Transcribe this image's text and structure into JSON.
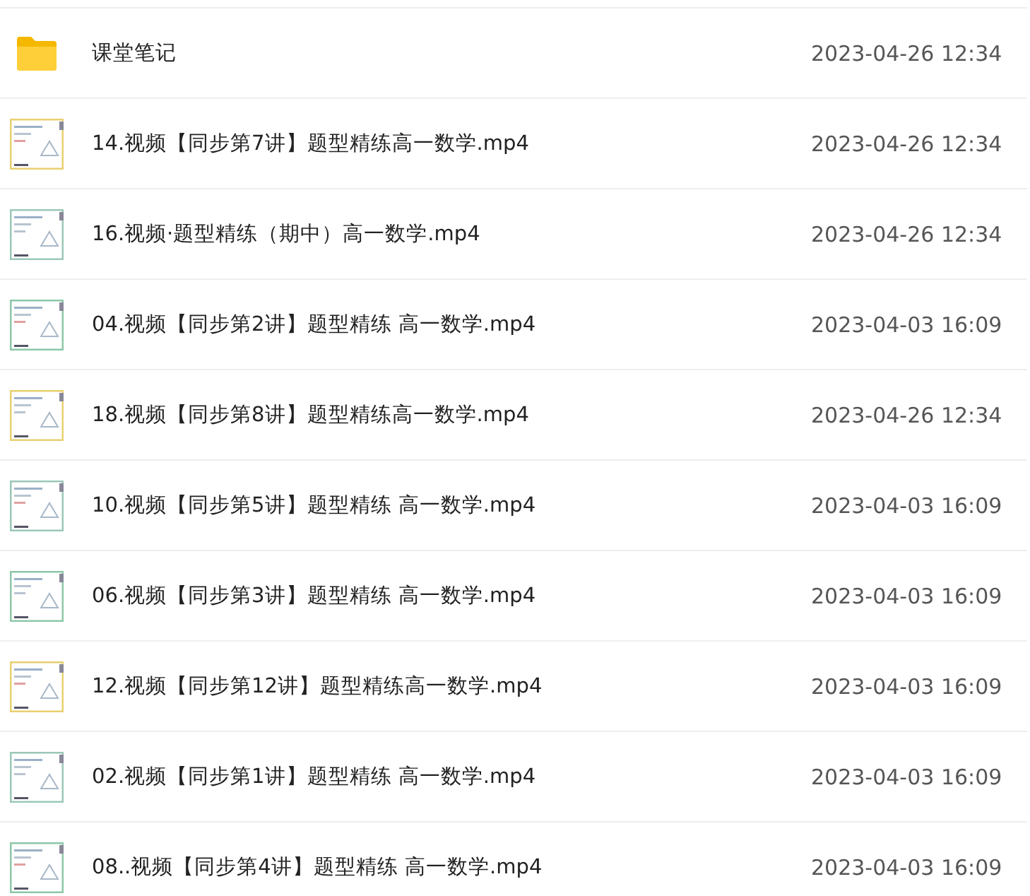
{
  "files": [
    {
      "kind": "folder",
      "name": "课堂笔记",
      "modified": "2023-04-26 12:34"
    },
    {
      "kind": "video",
      "name": "14.视频【同步第7讲】题型精练高一数学.mp4",
      "modified": "2023-04-26 12:34"
    },
    {
      "kind": "video",
      "name": "16.视频·题型精练（期中）高一数学.mp4",
      "modified": "2023-04-26 12:34"
    },
    {
      "kind": "video",
      "name": "04.视频【同步第2讲】题型精练 高一数学.mp4",
      "modified": "2023-04-03 16:09"
    },
    {
      "kind": "video",
      "name": "18.视频【同步第8讲】题型精练高一数学.mp4",
      "modified": "2023-04-26 12:34"
    },
    {
      "kind": "video",
      "name": "10.视频【同步第5讲】题型精练 高一数学.mp4",
      "modified": "2023-04-03 16:09"
    },
    {
      "kind": "video",
      "name": "06.视频【同步第3讲】题型精练 高一数学.mp4",
      "modified": "2023-04-03 16:09"
    },
    {
      "kind": "video",
      "name": "12.视频【同步第12讲】题型精练高一数学.mp4",
      "modified": "2023-04-03 16:09"
    },
    {
      "kind": "video",
      "name": "02.视频【同步第1讲】题型精练 高一数学.mp4",
      "modified": "2023-04-03 16:09"
    },
    {
      "kind": "video",
      "name": "08..视频【同步第4讲】题型精练 高一数学.mp4",
      "modified": "2023-04-03 16:09"
    }
  ]
}
